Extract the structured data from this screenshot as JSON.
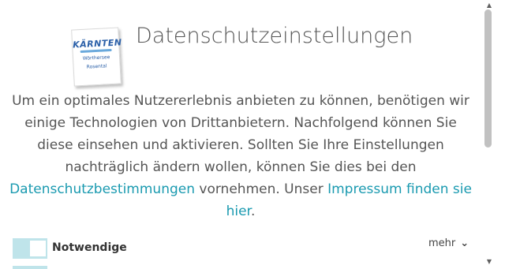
{
  "logo": {
    "brand": "KÄRNTEN",
    "sub_line1": "Wörthersee",
    "sub_line2": "Rosental"
  },
  "title": "Datenschutzeinstellungen",
  "intro": {
    "text1": "Um ein optimales Nutzererlebnis anbieten zu können, benötigen wir einige Technologien von Drittanbietern. Nachfolgend können Sie diese einsehen und aktivieren. Sollten Sie Ihre Einstellungen nachträglich ändern wollen, können Sie dies bei den ",
    "privacy_link": "Datenschutzbestimmungen",
    "text2": " vornehmen. Unser ",
    "imprint_link": "Impressum finden sie hier",
    "text3": "."
  },
  "category": {
    "label": "Notwendige",
    "toggle_on": true,
    "more_label": "mehr"
  },
  "colors": {
    "accent": "#1a9ab0",
    "toggle": "#bfe4ea"
  },
  "icons": {
    "more": "chevron-down-icon",
    "scroll_up": "arrow-up-icon",
    "scroll_down": "arrow-down-icon"
  }
}
